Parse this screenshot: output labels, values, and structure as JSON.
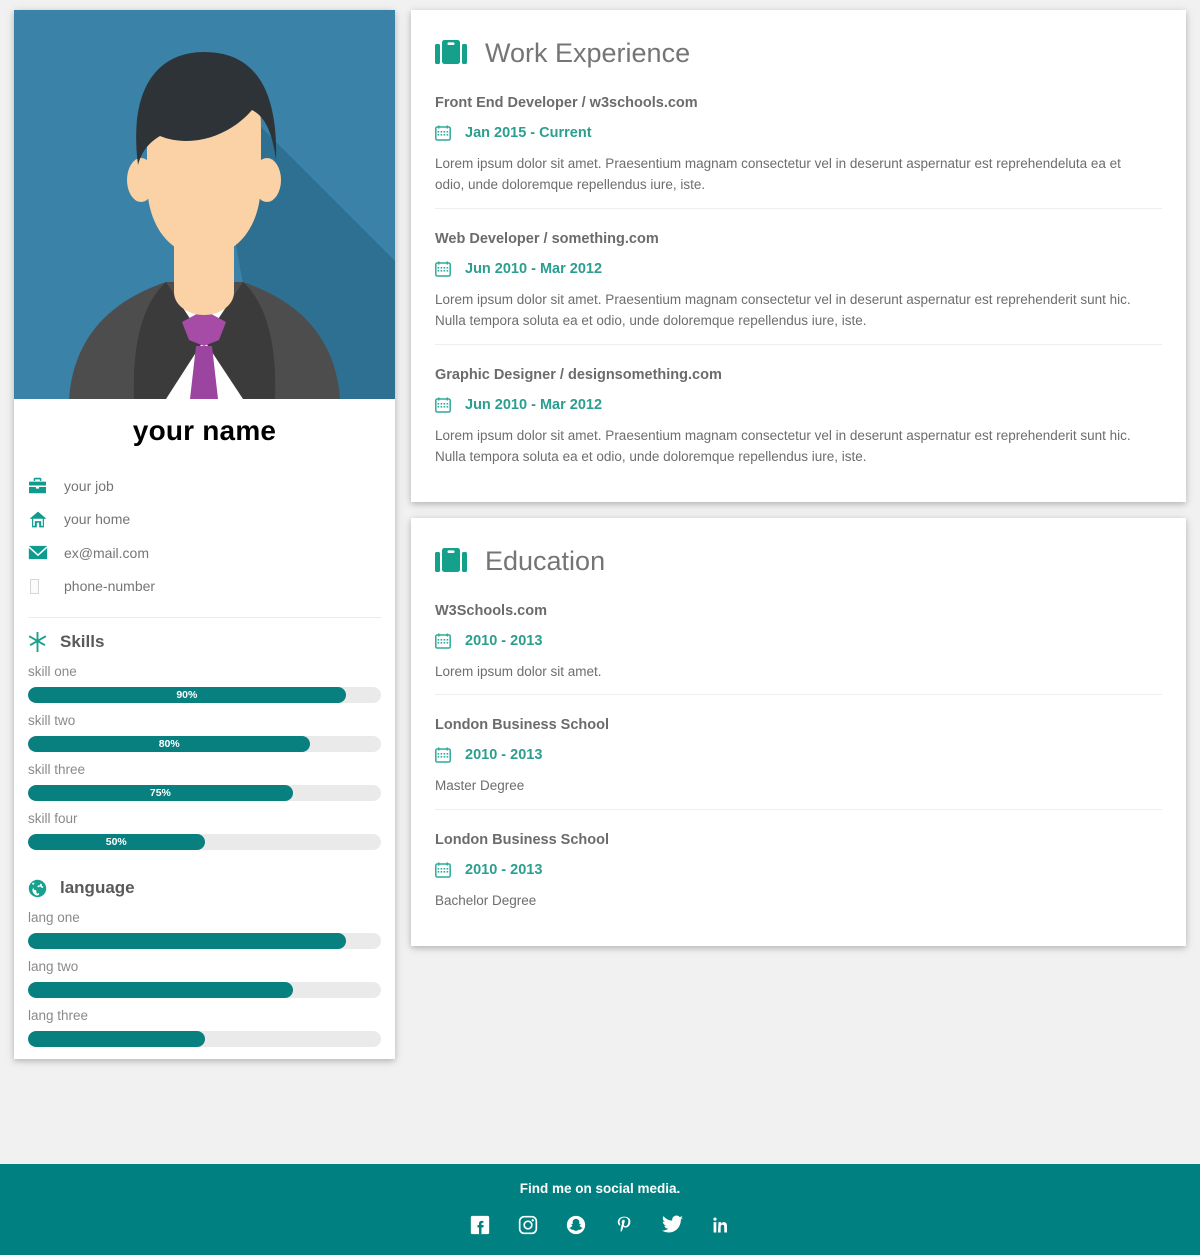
{
  "profile": {
    "name": "your name",
    "avatar_alt": "profile-photo",
    "contacts": [
      {
        "icon": "briefcase-icon",
        "label": "your job"
      },
      {
        "icon": "home-icon",
        "label": "your home"
      },
      {
        "icon": "envelope-icon",
        "label": "ex@mail.com"
      },
      {
        "icon": "phone-icon",
        "label": "phone-number"
      }
    ]
  },
  "skills": {
    "icon": "asterisk-icon",
    "title": "Skills",
    "items": [
      {
        "label": "skill one",
        "value": 90,
        "text": "90%"
      },
      {
        "label": "skill two",
        "value": 80,
        "text": "80%"
      },
      {
        "label": "skill three",
        "value": 75,
        "text": "75%"
      },
      {
        "label": "skill four",
        "value": 50,
        "text": "50%"
      }
    ]
  },
  "language": {
    "icon": "globe-icon",
    "title": "language",
    "items": [
      {
        "label": "lang one",
        "value": 90,
        "text": ""
      },
      {
        "label": "lang two",
        "value": 75,
        "text": ""
      },
      {
        "label": "lang three",
        "value": 50,
        "text": ""
      }
    ]
  },
  "work": {
    "icon": "briefcase-icon",
    "title": "Work Experience",
    "entries": [
      {
        "title": "Front End Developer / w3schools.com",
        "date": "Jan 2015 - Current",
        "body": "Lorem ipsum dolor sit amet. Praesentium magnam consectetur vel in deserunt aspernatur est reprehendeluta ea et odio, unde doloremque repellendus iure, iste."
      },
      {
        "title": "Web Developer / something.com",
        "date": "Jun 2010 - Mar 2012",
        "body": "Lorem ipsum dolor sit amet. Praesentium magnam consectetur vel in deserunt aspernatur est reprehenderit sunt hic. Nulla tempora soluta ea et odio, unde doloremque repellendus iure, iste."
      },
      {
        "title": "Graphic Designer / designsomething.com",
        "date": "Jun 2010 - Mar 2012",
        "body": "Lorem ipsum dolor sit amet. Praesentium magnam consectetur vel in deserunt aspernatur est reprehenderit sunt hic. Nulla tempora soluta ea et odio, unde doloremque repellendus iure, iste."
      }
    ]
  },
  "education": {
    "icon": "briefcase-icon",
    "title": "Education",
    "entries": [
      {
        "title": "W3Schools.com",
        "date": "2010 - 2013",
        "body": "Lorem ipsum dolor sit amet."
      },
      {
        "title": "London Business School",
        "date": "2010 - 2013",
        "body": "Master Degree"
      },
      {
        "title": "London Business School",
        "date": "2010 - 2013",
        "body": "Bachelor Degree"
      }
    ]
  },
  "footer": {
    "text": "Find me on social media.",
    "socials": [
      {
        "name": "facebook-icon"
      },
      {
        "name": "instagram-icon"
      },
      {
        "name": "snapchat-icon"
      },
      {
        "name": "pinterest-icon"
      },
      {
        "name": "twitter-icon"
      },
      {
        "name": "linkedin-icon"
      }
    ]
  },
  "colors": {
    "accent": "#008080",
    "bar_fill": "#08807f",
    "bar_track": "#eaeaea",
    "icon_teal": "#15a08c",
    "date_teal": "#2b9e8f",
    "page_bg": "#f1f1f1",
    "card_bg": "#ffffff",
    "heading_gray": "#757575",
    "body_gray": "#6d6d6d"
  }
}
